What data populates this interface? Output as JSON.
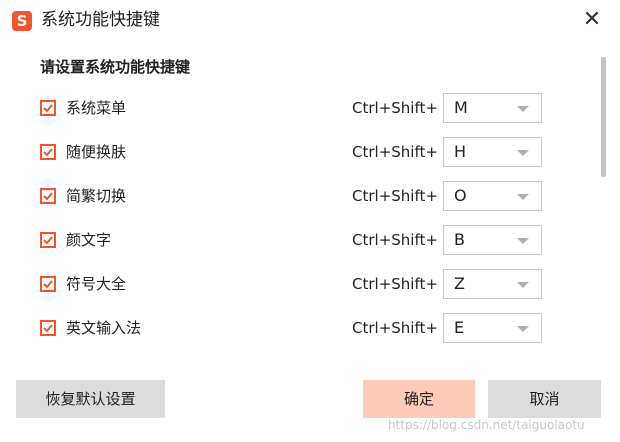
{
  "window": {
    "logo_text": "S",
    "title": "系统功能快捷键",
    "close_symbol": "✕"
  },
  "section_title": "请设置系统功能快捷键",
  "rows": [
    {
      "label": "系统菜单",
      "modifier": "Ctrl+Shift+",
      "key": "M",
      "checked": true
    },
    {
      "label": "随便换肤",
      "modifier": "Ctrl+Shift+",
      "key": "H",
      "checked": true
    },
    {
      "label": "简繁切换",
      "modifier": "Ctrl+Shift+",
      "key": "O",
      "checked": true
    },
    {
      "label": "颜文字",
      "modifier": "Ctrl+Shift+",
      "key": "B",
      "checked": true
    },
    {
      "label": "符号大全",
      "modifier": "Ctrl+Shift+",
      "key": "Z",
      "checked": true
    },
    {
      "label": "英文输入法",
      "modifier": "Ctrl+Shift+",
      "key": "E",
      "checked": true
    }
  ],
  "buttons": {
    "restore": "恢复默认设置",
    "ok": "确定",
    "cancel": "取消"
  },
  "watermark": "https://blog.csdn.net/taiguolaotu",
  "colors": {
    "accent": "#f2552c",
    "ok_button_bg": "#ffcab9",
    "secondary_button_bg": "#dcdcdc"
  }
}
